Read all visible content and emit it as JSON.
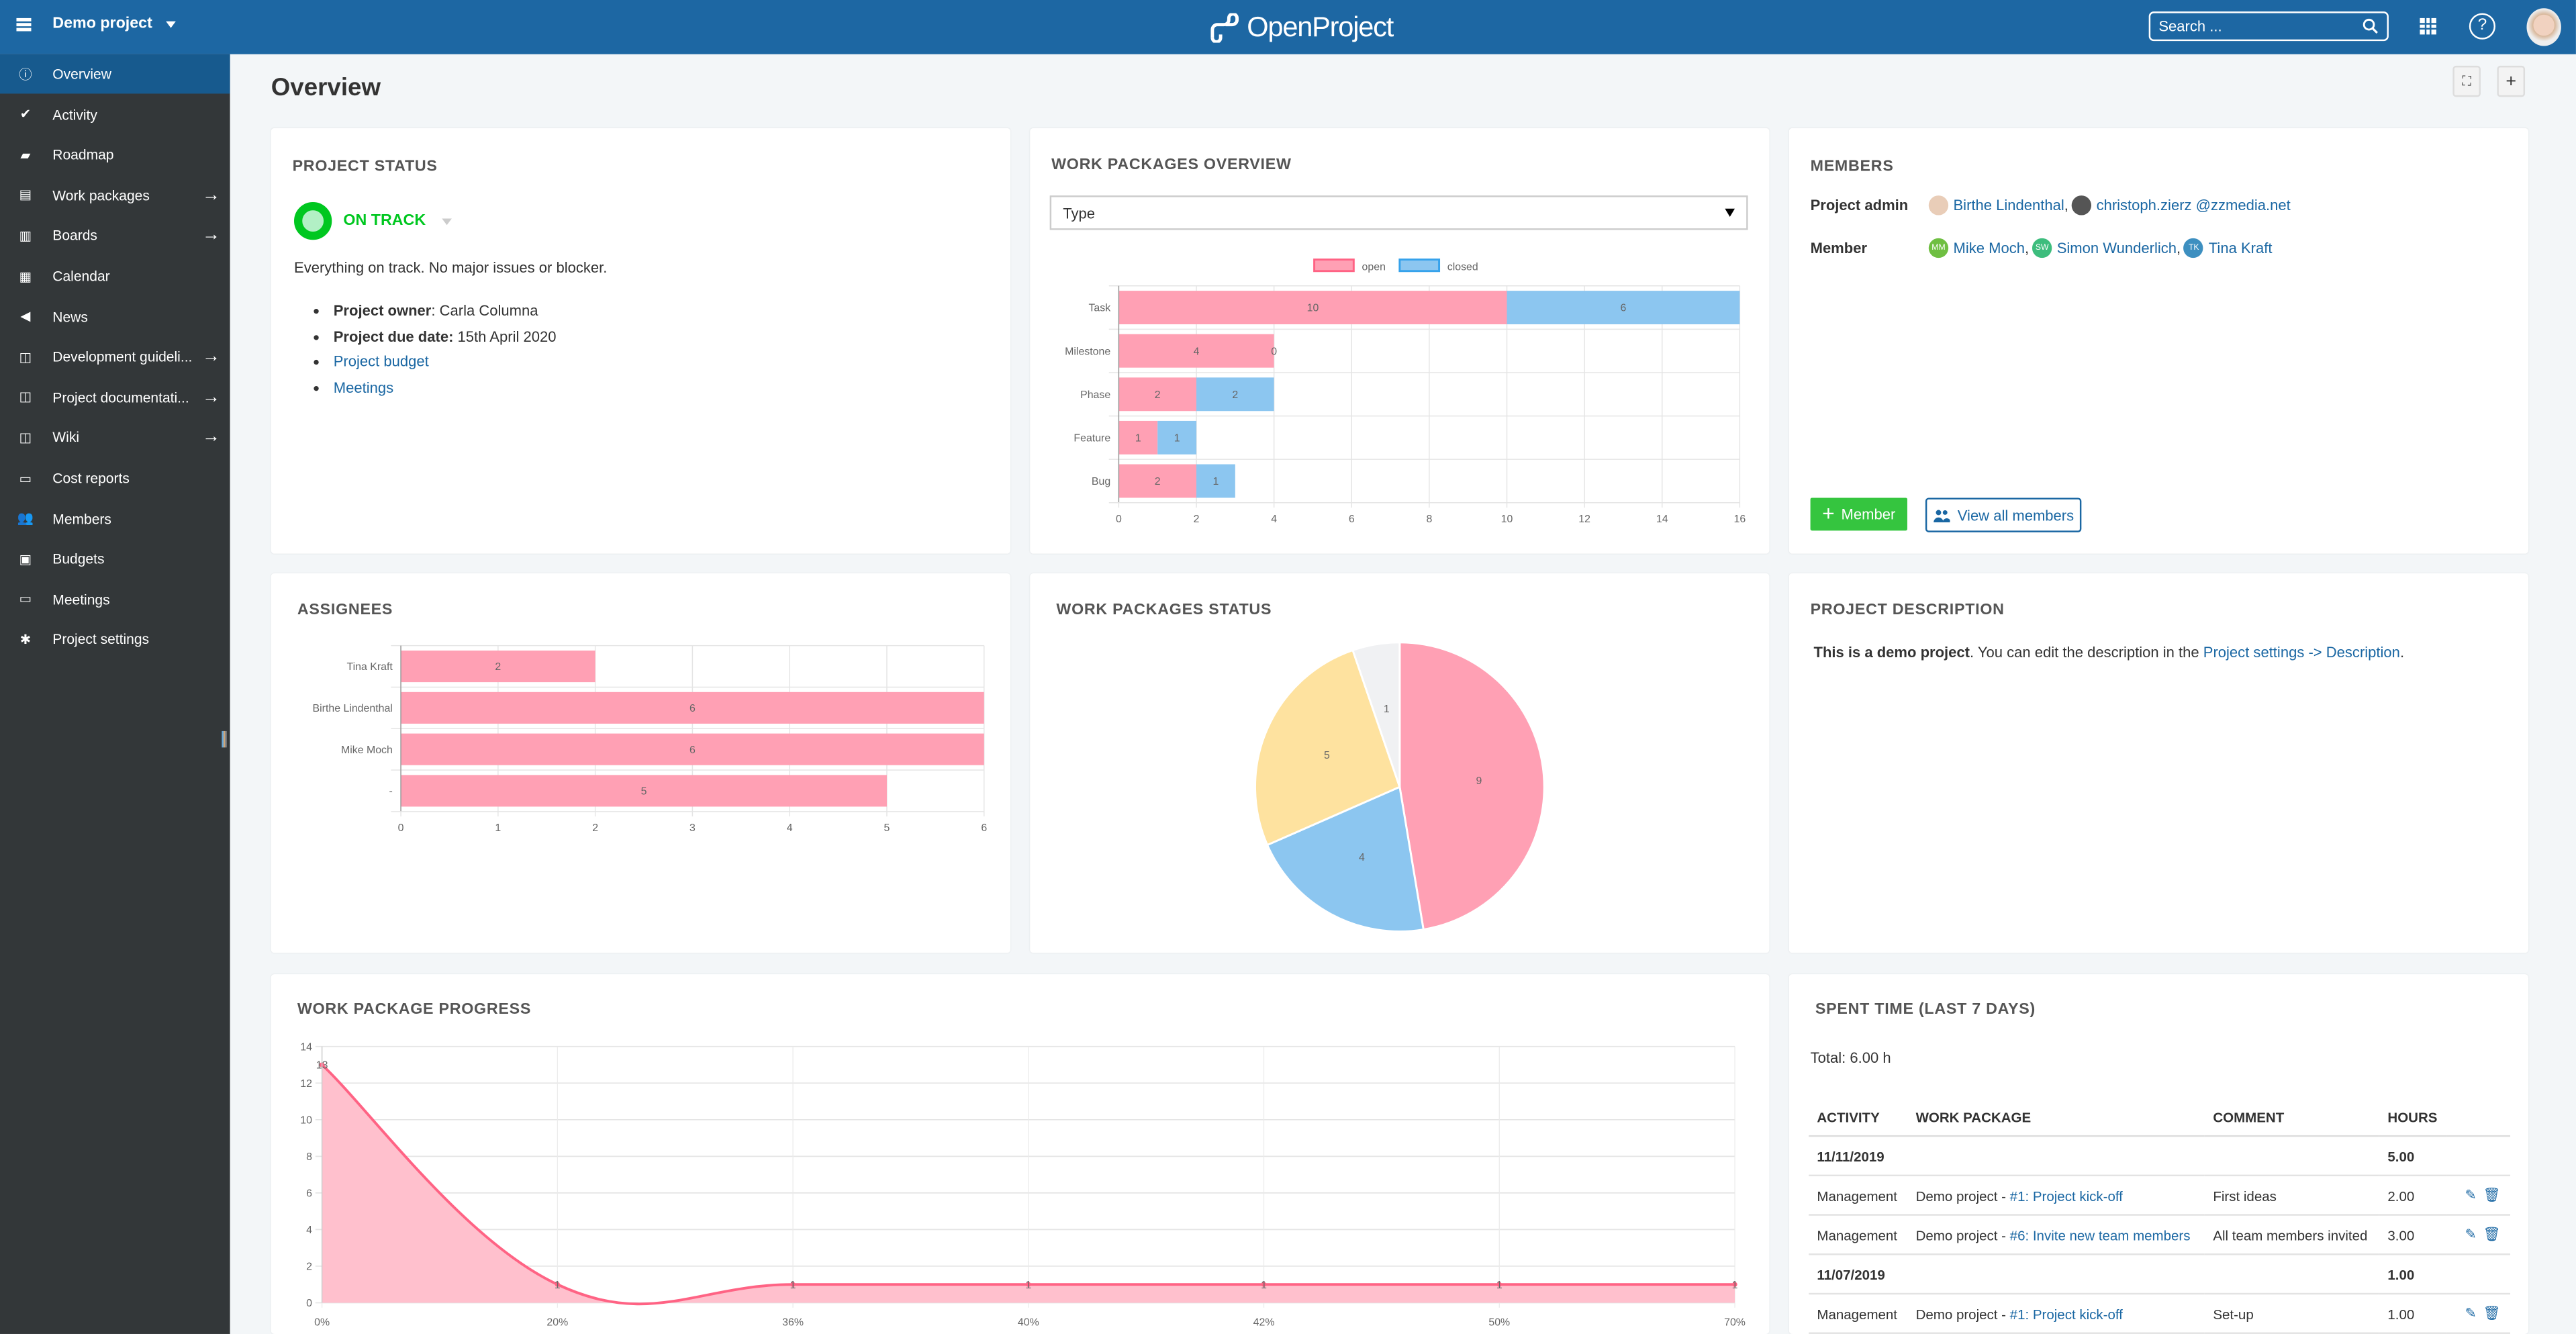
{
  "header": {
    "project_name": "Demo project",
    "logo_text": "OpenProject",
    "search_placeholder": "Search ...",
    "icons": [
      "menu-icon",
      "modules-grid-icon",
      "help-icon",
      "user-avatar"
    ]
  },
  "sidebar": {
    "items": [
      {
        "label": "Overview",
        "icon": "info-icon",
        "active": true,
        "arrow": false
      },
      {
        "label": "Activity",
        "icon": "checkmark-icon",
        "active": false,
        "arrow": false
      },
      {
        "label": "Roadmap",
        "icon": "tag-icon",
        "active": false,
        "arrow": false
      },
      {
        "label": "Work packages",
        "icon": "work-packages-icon",
        "active": false,
        "arrow": true
      },
      {
        "label": "Boards",
        "icon": "boards-icon",
        "active": false,
        "arrow": true
      },
      {
        "label": "Calendar",
        "icon": "calendar-icon",
        "active": false,
        "arrow": false
      },
      {
        "label": "News",
        "icon": "megaphone-icon",
        "active": false,
        "arrow": false
      },
      {
        "label": "Development guideli...",
        "icon": "book-icon",
        "active": false,
        "arrow": true
      },
      {
        "label": "Project documentati...",
        "icon": "book-icon",
        "active": false,
        "arrow": true
      },
      {
        "label": "Wiki",
        "icon": "book-icon",
        "active": false,
        "arrow": true
      },
      {
        "label": "Cost reports",
        "icon": "cost-reports-icon",
        "active": false,
        "arrow": false
      },
      {
        "label": "Members",
        "icon": "members-icon",
        "active": false,
        "arrow": false
      },
      {
        "label": "Budgets",
        "icon": "budgets-icon",
        "active": false,
        "arrow": false
      },
      {
        "label": "Meetings",
        "icon": "speech-bubble-icon",
        "active": false,
        "arrow": false
      },
      {
        "label": "Project settings",
        "icon": "gears-icon",
        "active": false,
        "arrow": false
      }
    ],
    "arrow_glyph": "→"
  },
  "page": {
    "title": "Overview",
    "fullscreen_glyph": "⛶",
    "add_glyph": "+"
  },
  "project_status": {
    "title": "PROJECT STATUS",
    "status": "ON TRACK",
    "status_color": "#00c720",
    "text": "Everything on track. No major issues or blocker.",
    "owner_label": "Project owner",
    "owner_value": ": Carla Columna",
    "due_label": "Project due date:",
    "due_value": " 15th April 2020",
    "links": [
      "Project budget",
      "Meetings"
    ]
  },
  "wp_overview": {
    "title": "WORK PACKAGES OVERVIEW",
    "select_value": "Type"
  },
  "members": {
    "title": "MEMBERS",
    "roles": [
      {
        "role": "Project admin",
        "people": [
          {
            "name": "Birthe Lindenthal",
            "initials": "",
            "color": "#e9cdb8"
          },
          {
            "name": "christoph.zierz @zzmedia.net",
            "initials": "",
            "color": "#555555"
          }
        ]
      },
      {
        "role": "Member",
        "people": [
          {
            "name": "Mike Moch",
            "initials": "MM",
            "color": "#6fbf42"
          },
          {
            "name": "Simon Wunderlich",
            "initials": "SW",
            "color": "#3dbd7d"
          },
          {
            "name": "Tina Kraft",
            "initials": "TK",
            "color": "#3d8fc0"
          }
        ]
      }
    ],
    "add_button": "Member",
    "view_all_button": "View all members"
  },
  "assignees": {
    "title": "ASSIGNEES"
  },
  "wp_status": {
    "title": "WORK PACKAGES STATUS"
  },
  "description": {
    "title": "PROJECT DESCRIPTION",
    "bold": "This is a demo project",
    "text": ". You can edit the description in the ",
    "link": "Project settings -> Description",
    "end": "."
  },
  "progress": {
    "title": "WORK PACKAGE PROGRESS"
  },
  "spent_time": {
    "title": "SPENT TIME (LAST 7 DAYS)",
    "total": "Total: 6.00 h",
    "columns": [
      "ACTIVITY",
      "WORK PACKAGE",
      "COMMENT",
      "HOURS"
    ],
    "rows": [
      {
        "type": "date",
        "date": "11/11/2019",
        "hours": "5.00"
      },
      {
        "type": "entry",
        "activity": "Management",
        "project": "Demo project - ",
        "wp": "#1: Project kick-off",
        "comment": "First ideas",
        "hours": "2.00"
      },
      {
        "type": "entry",
        "activity": "Management",
        "project": "Demo project - ",
        "wp": "#6: Invite new team members",
        "comment": "All team members invited",
        "hours": "3.00"
      },
      {
        "type": "date",
        "date": "11/07/2019",
        "hours": "1.00"
      },
      {
        "type": "entry",
        "activity": "Management",
        "project": "Demo project - ",
        "wp": "#1: Project kick-off",
        "comment": "Set-up",
        "hours": "1.00"
      }
    ]
  },
  "chart_data": [
    {
      "id": "wp-overview",
      "type": "bar",
      "orientation": "horizontal",
      "stacked": true,
      "title": "WORK PACKAGES OVERVIEW",
      "categories": [
        "Task",
        "Milestone",
        "Phase",
        "Feature",
        "Bug"
      ],
      "series": [
        {
          "name": "open",
          "values": [
            10,
            4,
            2,
            1,
            2
          ],
          "color": "#ffa0b4",
          "border": "#ff6384"
        },
        {
          "name": "closed",
          "values": [
            6,
            0,
            2,
            1,
            1
          ],
          "color": "#8cc6f0",
          "border": "#36a2eb"
        }
      ],
      "xlim": [
        0,
        16
      ],
      "xticks": [
        0,
        2,
        4,
        6,
        8,
        10,
        12,
        14,
        16
      ],
      "legend": "top",
      "grid": true
    },
    {
      "id": "assignees",
      "type": "bar",
      "orientation": "horizontal",
      "title": "ASSIGNEES",
      "categories": [
        "Tina Kraft",
        "Birthe Lindenthal",
        "Mike Moch",
        "-"
      ],
      "values": [
        2,
        6,
        6,
        5
      ],
      "color": "#ffa0b4",
      "xlim": [
        0,
        6
      ],
      "xticks": [
        0,
        1,
        2,
        3,
        4,
        5,
        6
      ],
      "grid": true
    },
    {
      "id": "wp-status",
      "type": "pie",
      "title": "WORK PACKAGES STATUS",
      "values": [
        9,
        4,
        5,
        1
      ],
      "colors": [
        "#ffa0b4",
        "#8cc6f0",
        "#fee29f",
        "#f0f1f3"
      ]
    },
    {
      "id": "wp-progress",
      "type": "area",
      "title": "WORK PACKAGE PROGRESS",
      "x": [
        "0%",
        "20%",
        "36%",
        "40%",
        "42%",
        "50%",
        "70%"
      ],
      "values": [
        13,
        1,
        1,
        1,
        1,
        1,
        1
      ],
      "ylim": [
        0,
        14
      ],
      "yticks": [
        0,
        2,
        4,
        6,
        8,
        10,
        12,
        14
      ],
      "line_color": "#ff6384",
      "fill_color": "#ffc0cd",
      "grid": true
    }
  ]
}
